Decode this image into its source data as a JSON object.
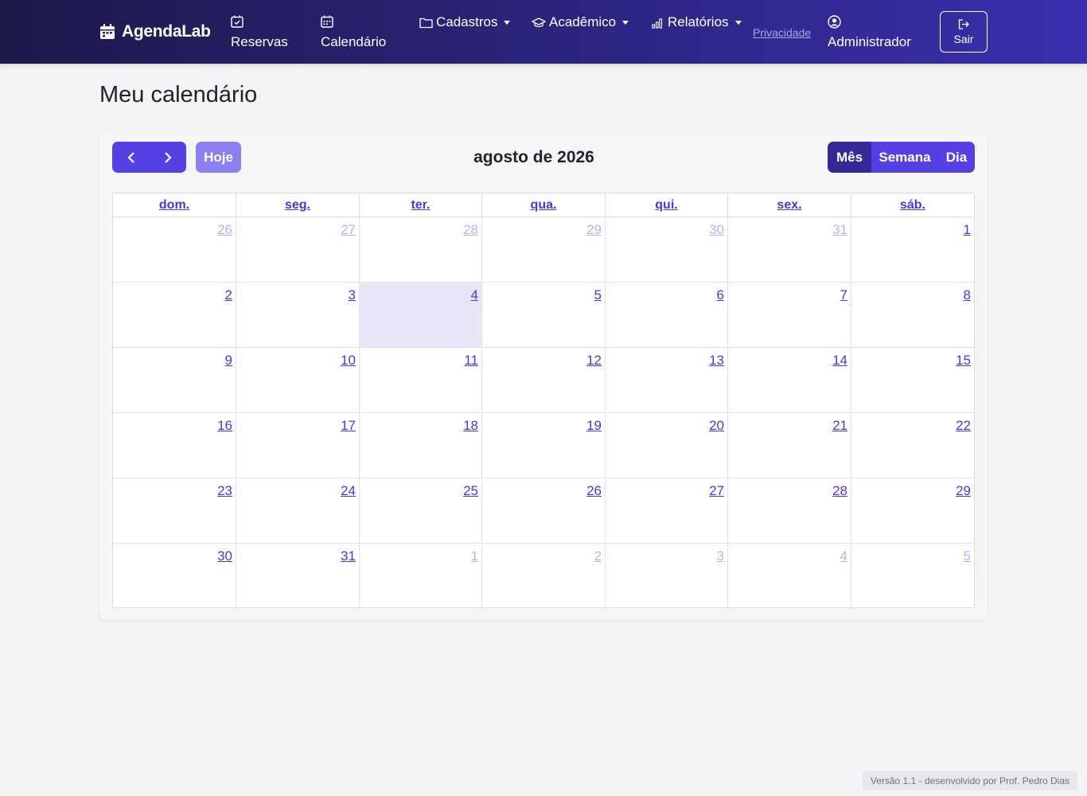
{
  "nav": {
    "brand": "AgendaLab",
    "reservas": "Reservas",
    "calendario": "Calendário",
    "cadastros": "Cadastros",
    "academico": "Acadêmico",
    "relatorios": "Relatórios",
    "privacidade": "Privacidade",
    "usuario": "Administrador",
    "sair": "Sair"
  },
  "page": {
    "title": "Meu calendário"
  },
  "toolbar": {
    "today": "Hoje",
    "title": "agosto de 2026",
    "month": "Mês",
    "week": "Semana",
    "day": "Dia"
  },
  "calendar": {
    "weekdays": [
      "dom.",
      "seg.",
      "ter.",
      "qua.",
      "qui.",
      "sex.",
      "sáb."
    ],
    "weeks": [
      [
        {
          "d": "26",
          "other": true
        },
        {
          "d": "27",
          "other": true
        },
        {
          "d": "28",
          "other": true
        },
        {
          "d": "29",
          "other": true
        },
        {
          "d": "30",
          "other": true
        },
        {
          "d": "31",
          "other": true
        },
        {
          "d": "1",
          "other": false
        }
      ],
      [
        {
          "d": "2",
          "other": false
        },
        {
          "d": "3",
          "other": false
        },
        {
          "d": "4",
          "other": false,
          "today": true
        },
        {
          "d": "5",
          "other": false
        },
        {
          "d": "6",
          "other": false
        },
        {
          "d": "7",
          "other": false
        },
        {
          "d": "8",
          "other": false
        }
      ],
      [
        {
          "d": "9",
          "other": false
        },
        {
          "d": "10",
          "other": false
        },
        {
          "d": "11",
          "other": false
        },
        {
          "d": "12",
          "other": false
        },
        {
          "d": "13",
          "other": false
        },
        {
          "d": "14",
          "other": false
        },
        {
          "d": "15",
          "other": false
        }
      ],
      [
        {
          "d": "16",
          "other": false
        },
        {
          "d": "17",
          "other": false
        },
        {
          "d": "18",
          "other": false
        },
        {
          "d": "19",
          "other": false
        },
        {
          "d": "20",
          "other": false
        },
        {
          "d": "21",
          "other": false
        },
        {
          "d": "22",
          "other": false
        }
      ],
      [
        {
          "d": "23",
          "other": false
        },
        {
          "d": "24",
          "other": false
        },
        {
          "d": "25",
          "other": false
        },
        {
          "d": "26",
          "other": false
        },
        {
          "d": "27",
          "other": false
        },
        {
          "d": "28",
          "other": false
        },
        {
          "d": "29",
          "other": false
        }
      ],
      [
        {
          "d": "30",
          "other": false
        },
        {
          "d": "31",
          "other": false
        },
        {
          "d": "1",
          "other": true
        },
        {
          "d": "2",
          "other": true
        },
        {
          "d": "3",
          "other": true
        },
        {
          "d": "4",
          "other": true
        },
        {
          "d": "5",
          "other": true
        }
      ]
    ]
  },
  "footer": {
    "text": "Versão 1.1 - desenvolvido por Prof. Pedro Dias"
  },
  "colors": {
    "accent": "#5540e3",
    "accent_dark": "#35299a",
    "today_bg": "#e6e6f7"
  }
}
